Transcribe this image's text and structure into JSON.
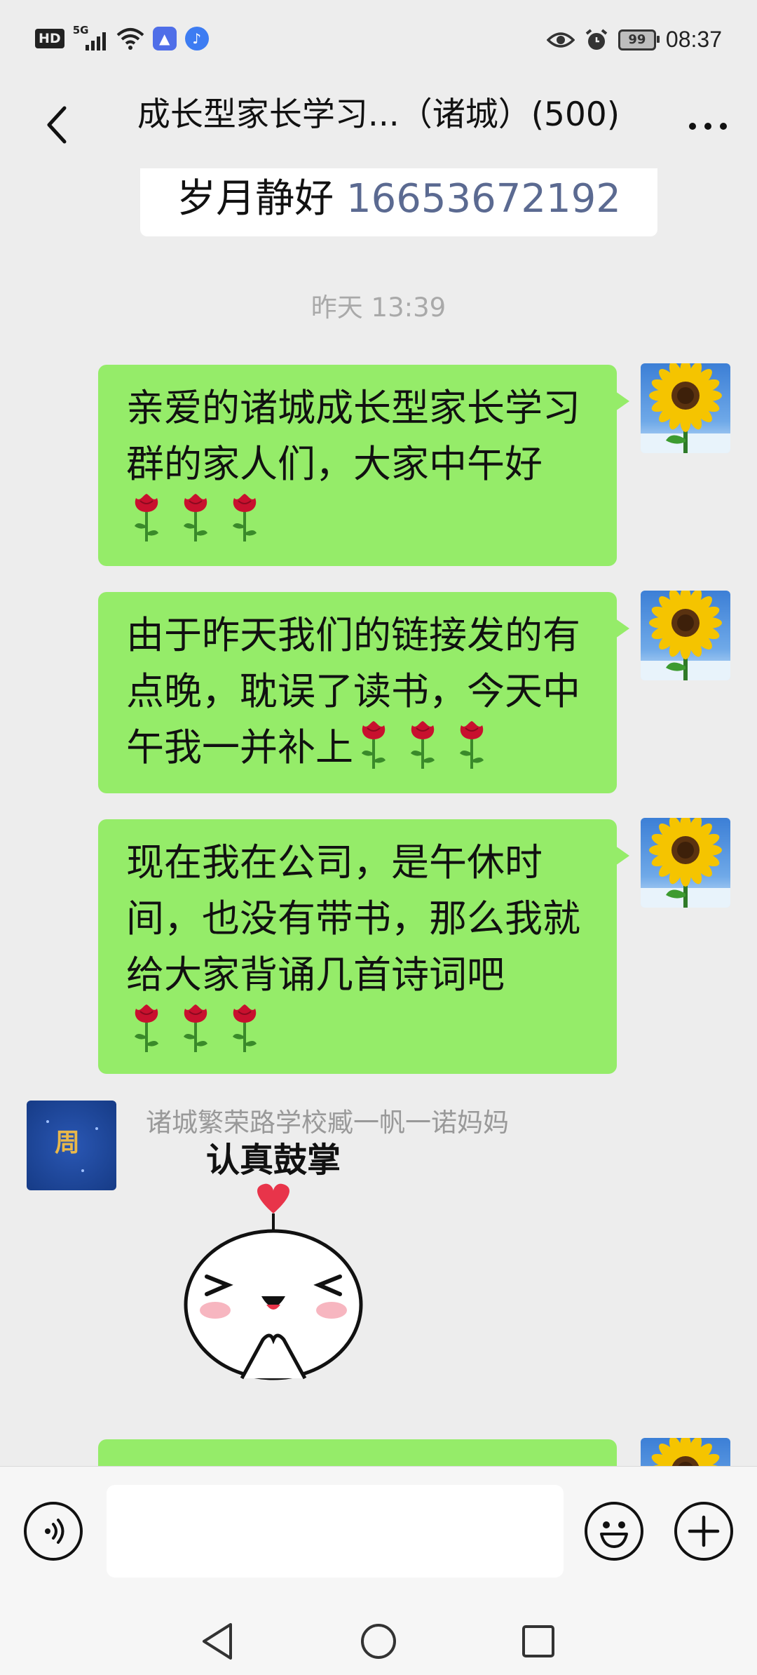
{
  "status_bar": {
    "hd": "HD",
    "network": "5G",
    "battery": "99",
    "time": "08:37"
  },
  "header": {
    "title": "成长型家长学习...（诸城）(500)"
  },
  "chat": {
    "prev_card": {
      "name": "岁月静好",
      "phone": "16653672192"
    },
    "timestamp": "昨天 13:39",
    "messages": [
      {
        "text": "亲爱的诸城成长型家长学习群的家人们，大家中午好",
        "roses": 3
      },
      {
        "text": "由于昨天我们的链接发的有点晚，耽误了读书，今天中午我一并补上",
        "roses": 3
      },
      {
        "text": "现在我在公司，是午休时间，也没有带书，那么我就给大家背诵几首诗词吧",
        "roses": 3
      }
    ],
    "received": {
      "sender": "诸城繁荣路学校臧一帆一诺妈妈",
      "sticker_caption": "认真鼓掌"
    }
  },
  "icons": {
    "back": "chevron-left-icon",
    "more": "more-dots-icon",
    "voice": "voice-icon",
    "emoji": "emoji-icon",
    "plus": "plus-icon",
    "rose": "rose-icon"
  },
  "colors": {
    "bubble_sent": "#95ec69",
    "background": "#ededed",
    "timestamp": "#a9a9a9",
    "link_phone": "#5b6a91"
  }
}
